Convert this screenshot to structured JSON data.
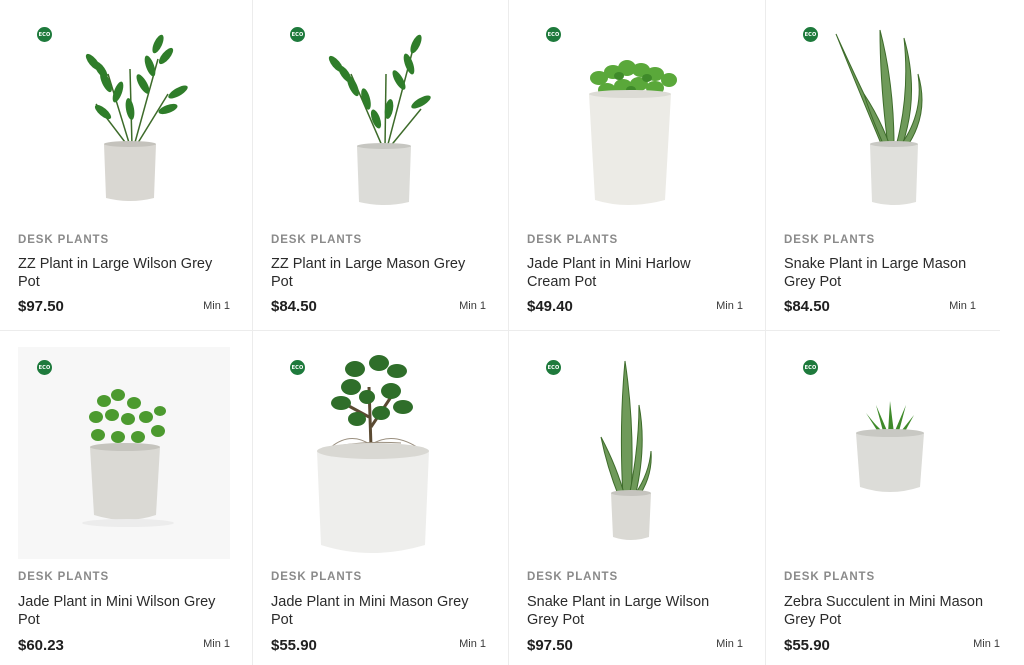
{
  "products": [
    {
      "category": "DESK PLANTS",
      "title": "ZZ Plant in Large Wilson Grey Pot",
      "price": "$97.50",
      "min": "Min 1",
      "eco": "ECO"
    },
    {
      "category": "DESK PLANTS",
      "title": "ZZ Plant in Large Mason Grey Pot",
      "price": "$84.50",
      "min": "Min 1",
      "eco": "ECO"
    },
    {
      "category": "DESK PLANTS",
      "title": "Jade Plant in Mini Harlow Cream Pot",
      "price": "$49.40",
      "min": "Min 1",
      "eco": "ECO"
    },
    {
      "category": "DESK PLANTS",
      "title": "Snake Plant in Large Mason Grey Pot",
      "price": "$84.50",
      "min": "Min 1",
      "eco": "ECO"
    },
    {
      "category": "DESK PLANTS",
      "title": "Jade Plant in Mini Wilson Grey Pot",
      "price": "$60.23",
      "min": "Min 1",
      "eco": "ECO"
    },
    {
      "category": "DESK PLANTS",
      "title": "Jade Plant in Mini Mason Grey Pot",
      "price": "$55.90",
      "min": "Min 1",
      "eco": "ECO"
    },
    {
      "category": "DESK PLANTS",
      "title": "Snake Plant in Large Wilson Grey Pot",
      "price": "$97.50",
      "min": "Min 1",
      "eco": "ECO"
    },
    {
      "category": "DESK PLANTS",
      "title": "Zebra Succulent in Mini Mason Grey Pot",
      "price": "$55.90",
      "min": "Min 1",
      "eco": "ECO"
    }
  ],
  "colors": {
    "eco_badge": "#1e7a3c",
    "leaf_dark": "#2f7d2a",
    "leaf_light": "#5aa83a",
    "pot_grey": "#d6d6d2",
    "pot_cream": "#ecebe6"
  }
}
